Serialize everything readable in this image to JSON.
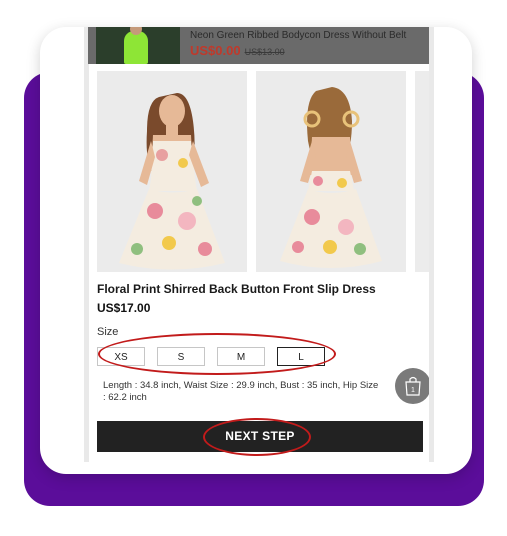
{
  "top_product": {
    "title": "Neon Green Ribbed Bodycon Dress Without Belt",
    "price": "US$0.00",
    "old_price": "US$13.00"
  },
  "product": {
    "title": "Floral Print Shirred Back Button Front Slip Dress",
    "price": "US$17.00"
  },
  "size": {
    "label": "Size",
    "options": [
      "XS",
      "S",
      "M",
      "L"
    ],
    "selected": "L"
  },
  "measurements": "Length : 34.8 inch, Waist Size : 29.9 inch, Bust : 35 inch, Hip Size : 62.2 inch",
  "cart": {
    "count": "1"
  },
  "next_button": "NEXT STEP",
  "colors": {
    "purple_background": "#5b0d9a",
    "annotation_red": "#c21b1b",
    "price_red": "#c0392b",
    "button_dark": "#222222"
  }
}
